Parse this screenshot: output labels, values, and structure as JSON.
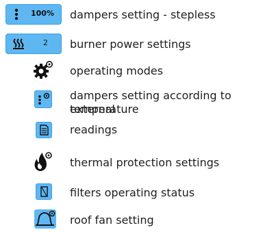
{
  "rows": [
    {
      "icon": "vertical-dots-icon",
      "value": "100%",
      "label": "dampers setting - stepless"
    },
    {
      "icon": "heating-waves-icon",
      "value": "2",
      "label": "burner power settings"
    },
    {
      "icon": "gears-icon",
      "label": "operating modes"
    },
    {
      "icon": "dots-gear-icon",
      "label_line1": "dampers setting according to external",
      "label_line2": "temperature"
    },
    {
      "icon": "document-icon",
      "label": "readings"
    },
    {
      "icon": "flame-gear-icon",
      "label": "thermal protection settings"
    },
    {
      "icon": "filter-icon",
      "label": "filters operating status"
    },
    {
      "icon": "bell-gear-icon",
      "label": "roof fan setting"
    }
  ],
  "colors": {
    "accent": "#5fb7f2",
    "accent_border": "#3aa0ea",
    "icon_dark": "#111111"
  }
}
